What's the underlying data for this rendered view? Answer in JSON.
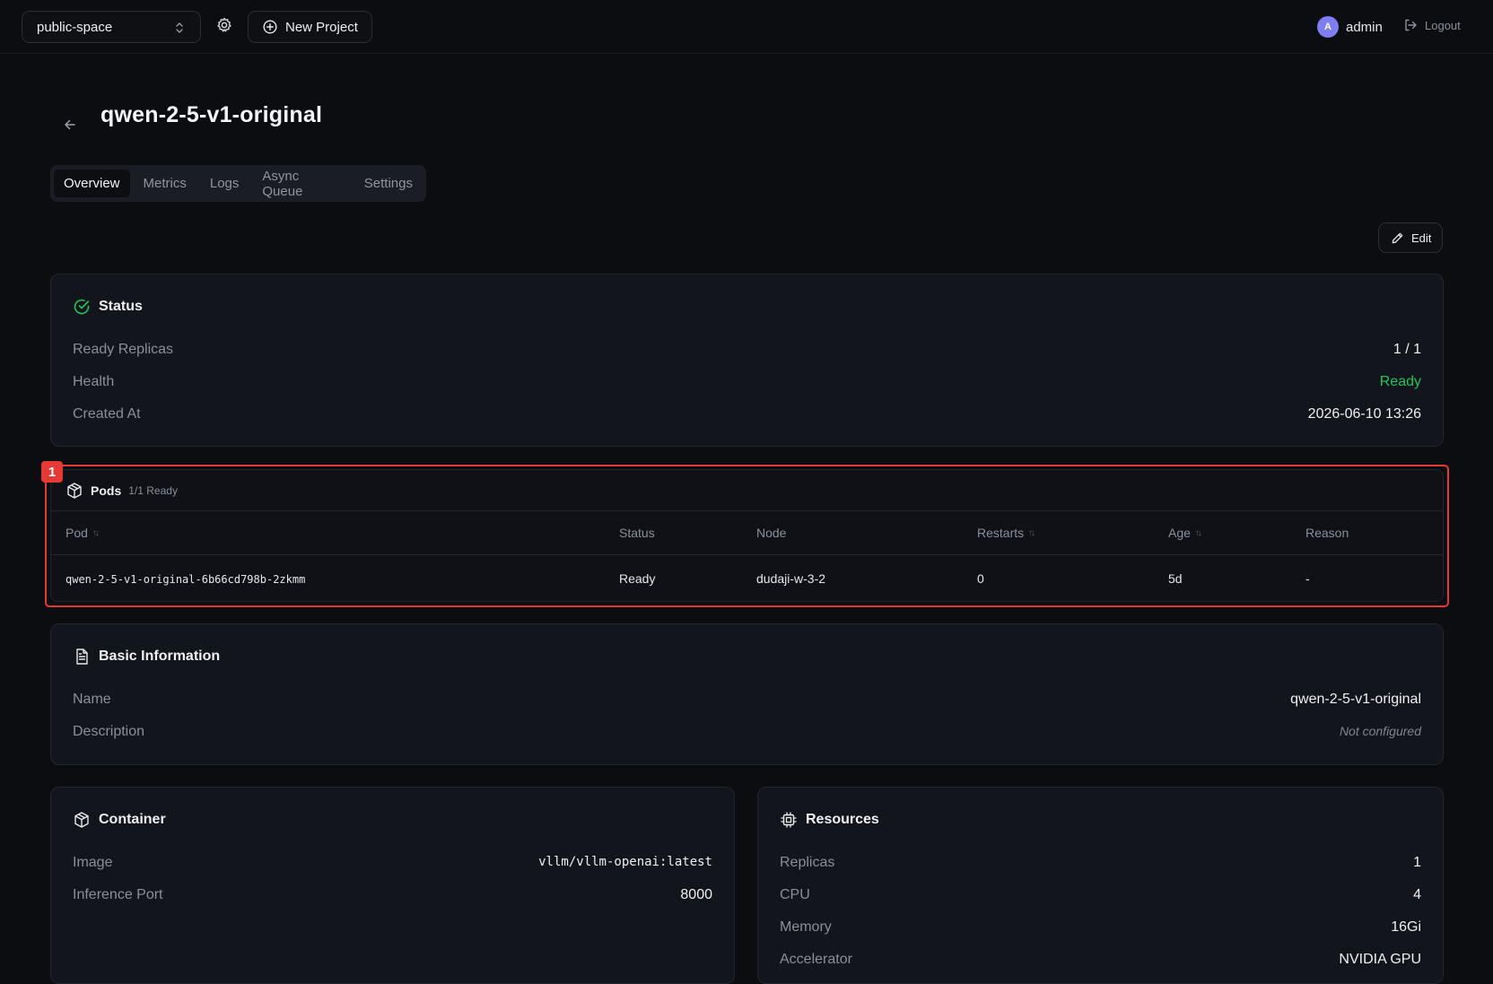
{
  "topbar": {
    "workspace": "public-space",
    "new_project_label": "New Project",
    "user_initial": "A",
    "user_name": "admin",
    "logout_label": "Logout"
  },
  "page": {
    "title": "qwen-2-5-v1-original",
    "tabs": [
      "Overview",
      "Metrics",
      "Logs",
      "Async Queue",
      "Settings"
    ],
    "active_tab": "Overview",
    "edit_label": "Edit"
  },
  "status": {
    "title": "Status",
    "rows": [
      {
        "label": "Ready Replicas",
        "value": "1 / 1"
      },
      {
        "label": "Health",
        "value": "Ready"
      },
      {
        "label": "Created At",
        "value": "2026-06-10 13:26"
      }
    ]
  },
  "pods": {
    "badge": "1",
    "title": "Pods",
    "subtitle": "1/1 Ready",
    "columns": [
      "Pod",
      "Status",
      "Node",
      "Restarts",
      "Age",
      "Reason"
    ],
    "rows": [
      {
        "pod": "qwen-2-5-v1-original-6b66cd798b-2zkmm",
        "status": "Ready",
        "node": "dudaji-w-3-2",
        "restarts": "0",
        "age": "5d",
        "reason": "-"
      }
    ]
  },
  "basic": {
    "title": "Basic Information",
    "rows": [
      {
        "label": "Name",
        "value": "qwen-2-5-v1-original"
      },
      {
        "label": "Description",
        "value": "Not configured"
      }
    ]
  },
  "container": {
    "title": "Container",
    "rows": [
      {
        "label": "Image",
        "value": "vllm/vllm-openai:latest"
      },
      {
        "label": "Inference Port",
        "value": "8000"
      }
    ]
  },
  "resources": {
    "title": "Resources",
    "rows": [
      {
        "label": "Replicas",
        "value": "1"
      },
      {
        "label": "CPU",
        "value": "4"
      },
      {
        "label": "Memory",
        "value": "16Gi"
      },
      {
        "label": "Accelerator",
        "value": "NVIDIA GPU"
      }
    ]
  },
  "colors": {
    "accent_green": "#22c55e",
    "highlight_red": "#e53935",
    "avatar": "#7e7ef0"
  },
  "icons": [
    "chevrons-up-down-icon",
    "gear-icon",
    "plus-circle-icon",
    "logout-icon",
    "arrow-left-icon",
    "pencil-icon",
    "check-circle-icon",
    "cube-icon",
    "document-icon",
    "cpu-icon",
    "sort-icon"
  ]
}
